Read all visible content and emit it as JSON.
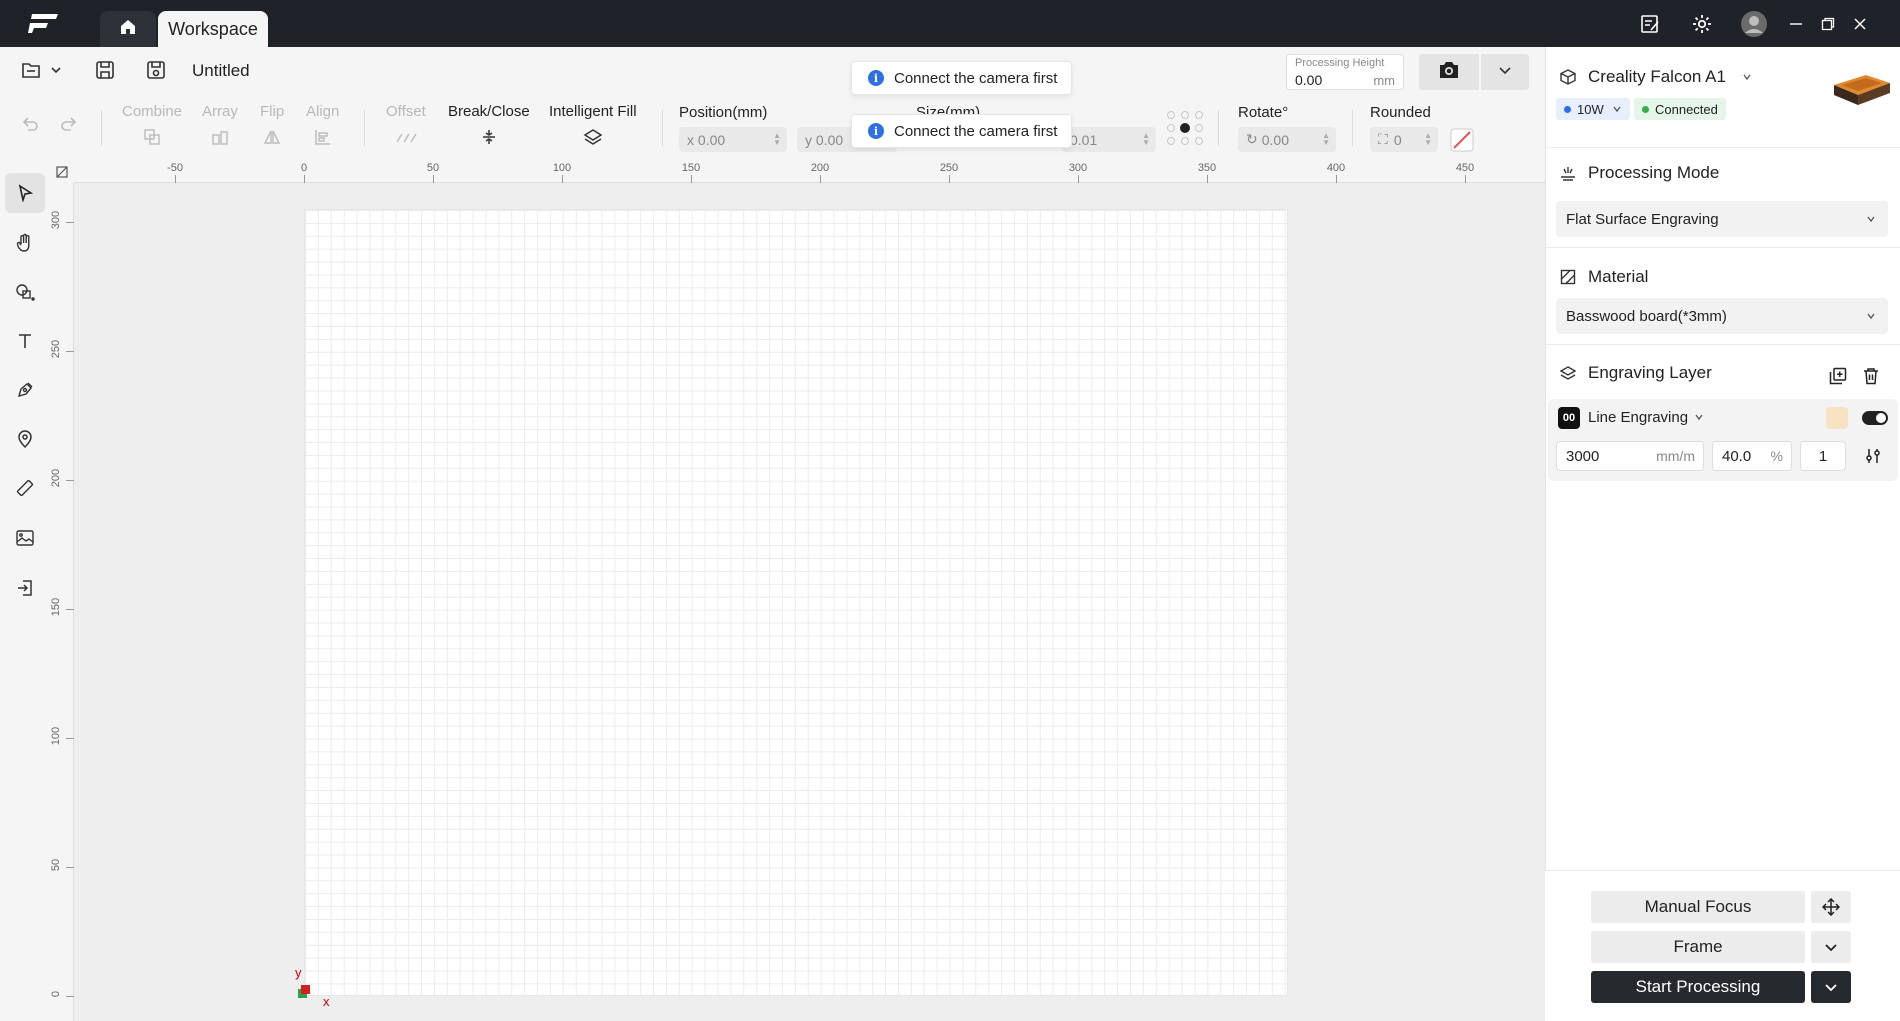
{
  "titlebar": {
    "tab_label": "Workspace"
  },
  "file": {
    "title": "Untitled"
  },
  "toolbar": {
    "combine": "Combine",
    "array": "Array",
    "flip": "Flip",
    "align": "Align",
    "offset": "Offset",
    "break_close": "Break/Close",
    "intelligent_fill": "Intelligent Fill",
    "position_label": "Position(mm)",
    "pos_x": "x 0.00",
    "pos_y": "y 0.00",
    "size_label": "Size(mm)",
    "size_h": "0.01",
    "rotate_label": "Rotate°",
    "rotate_val": "0.00",
    "rounded_label": "Rounded",
    "rounded_val": "0"
  },
  "processing_height": {
    "label": "Processing Height",
    "value": "0.00",
    "unit": "mm"
  },
  "toasts": [
    "Connect the camera first",
    "Connect the camera first"
  ],
  "ruler": {
    "top_ticks": [
      "-50",
      "0",
      "50",
      "100",
      "150",
      "200",
      "250",
      "300",
      "350",
      "400",
      "450"
    ],
    "left_ticks": [
      "300",
      "250",
      "200",
      "150",
      "100",
      "50",
      "0"
    ]
  },
  "axis": {
    "x": "x",
    "y": "y"
  },
  "device": {
    "name": "Creality Falcon A1",
    "power": "10W",
    "status": "Connected"
  },
  "processing_mode": {
    "title": "Processing Mode",
    "value": "Flat Surface Engraving"
  },
  "material": {
    "title": "Material",
    "value": "Basswood board(*3mm)"
  },
  "layer": {
    "title": "Engraving Layer",
    "index": "00",
    "name": "Line Engraving",
    "speed": "3000",
    "speed_unit": "mm/m",
    "power": "40.0",
    "power_unit": "%",
    "passes": "1",
    "swatch_color": "#f7e3c2"
  },
  "actions": {
    "manual_focus": "Manual Focus",
    "frame": "Frame",
    "start": "Start Processing"
  }
}
